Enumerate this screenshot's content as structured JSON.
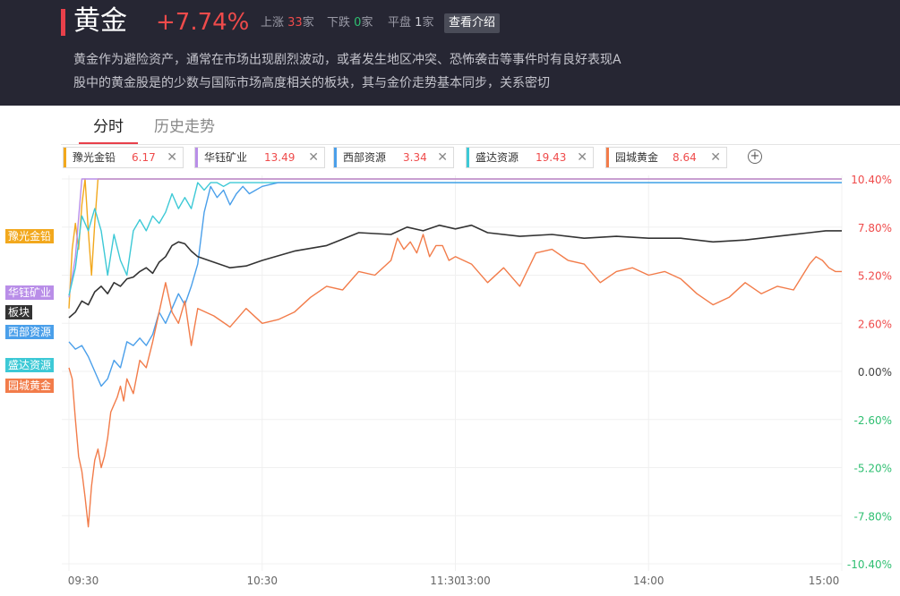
{
  "header": {
    "title": "黄金",
    "change": "+7.74%",
    "up_label": "上涨",
    "up_count": "33",
    "up_unit": "家",
    "down_label": "下跌",
    "down_count": "0",
    "down_unit": "家",
    "flat_label": "平盘",
    "flat_count": "1",
    "flat_unit": "家",
    "intro_button": "查看介绍",
    "description_line1": "黄金作为避险资产，通常在市场出现剧烈波动，或者发生地区冲突、恐怖袭击等事件时有良好表现A",
    "description_line2": "股中的黄金股是的少数与国际市场高度相关的板块，其与金价走势基本同步，关系密切"
  },
  "tabs": [
    {
      "label": "分时",
      "active": true
    },
    {
      "label": "历史走势",
      "active": false
    }
  ],
  "chips": [
    {
      "name": "豫光金铅",
      "value": "6.17",
      "color": "#f2a81d"
    },
    {
      "name": "华钰矿业",
      "value": "13.49",
      "color": "#b98ee8"
    },
    {
      "name": "西部资源",
      "value": "3.34",
      "color": "#4a9fea"
    },
    {
      "name": "盛达资源",
      "value": "19.43",
      "color": "#3dc9d6"
    },
    {
      "name": "园城黄金",
      "value": "8.64",
      "color": "#f27c4a"
    }
  ],
  "colors": {
    "sector": "#333333",
    "up": "#ef4b4b",
    "down": "#2fbf71"
  },
  "chart_data": {
    "type": "line",
    "x_ticks": [
      "09:30",
      "10:30",
      "11:30",
      "13:00",
      "14:00",
      "15:00"
    ],
    "y_ticks": [
      "10.40%",
      "7.80%",
      "5.20%",
      "2.60%",
      "0.00%",
      "-2.60%",
      "-5.20%",
      "-7.80%",
      "-10.40%"
    ],
    "ylim": [
      -10.4,
      10.4
    ],
    "x_unit": "minutes of trading session (0–240)",
    "series": [
      {
        "name": "板块",
        "color": "#333333",
        "x": [
          0,
          2,
          4,
          6,
          8,
          10,
          12,
          14,
          16,
          18,
          20,
          22,
          24,
          26,
          28,
          30,
          32,
          34,
          36,
          38,
          40,
          45,
          50,
          55,
          60,
          70,
          80,
          90,
          100,
          105,
          110,
          115,
          120,
          125,
          130,
          140,
          150,
          160,
          170,
          180,
          190,
          200,
          210,
          220,
          230,
          235,
          240
        ],
        "y": [
          2.9,
          3.2,
          3.8,
          3.6,
          4.3,
          4.6,
          4.2,
          4.8,
          4.6,
          5.0,
          5.1,
          5.4,
          5.6,
          5.3,
          5.9,
          6.2,
          6.8,
          7.0,
          6.9,
          6.5,
          6.2,
          5.9,
          5.6,
          5.7,
          6.0,
          6.5,
          6.8,
          7.5,
          7.4,
          7.8,
          7.6,
          7.9,
          7.7,
          7.9,
          7.5,
          7.3,
          7.4,
          7.2,
          7.3,
          7.2,
          7.2,
          7.0,
          7.1,
          7.3,
          7.5,
          7.6,
          7.6
        ]
      },
      {
        "name": "豫光金铅",
        "color": "#f2a81d",
        "x": [
          0,
          1,
          2,
          3,
          4,
          5,
          6,
          7,
          8,
          9,
          10,
          240
        ],
        "y": [
          3.4,
          6.6,
          8.0,
          6.6,
          9.0,
          10.4,
          7.6,
          5.2,
          8.0,
          10.4,
          10.4,
          10.4
        ]
      },
      {
        "name": "盛达资源",
        "color": "#3dc9d6",
        "x": [
          0,
          2,
          4,
          6,
          8,
          10,
          12,
          14,
          16,
          18,
          20,
          22,
          24,
          26,
          28,
          30,
          32,
          34,
          36,
          38,
          40,
          42,
          44,
          46,
          48,
          50,
          55,
          60,
          65,
          240
        ],
        "y": [
          4.1,
          5.6,
          8.4,
          7.6,
          8.8,
          7.6,
          5.2,
          7.4,
          6.0,
          5.2,
          7.6,
          8.2,
          7.6,
          8.4,
          8.0,
          8.6,
          9.6,
          8.8,
          9.4,
          8.8,
          10.2,
          9.8,
          10.2,
          10.2,
          10.0,
          10.2,
          10.2,
          10.2,
          10.2,
          10.2
        ]
      },
      {
        "name": "华钰矿业",
        "color": "#b98ee8",
        "x": [
          0,
          2,
          4,
          6,
          240
        ],
        "y": [
          4.0,
          6.2,
          10.4,
          10.4,
          10.4
        ]
      },
      {
        "name": "西部资源",
        "color": "#4a9fea",
        "x": [
          0,
          2,
          4,
          6,
          8,
          10,
          12,
          14,
          16,
          18,
          20,
          22,
          24,
          26,
          28,
          30,
          32,
          34,
          36,
          38,
          40,
          42,
          44,
          46,
          48,
          50,
          52,
          54,
          56,
          58,
          60,
          65,
          70,
          240
        ],
        "y": [
          1.6,
          1.2,
          1.4,
          0.8,
          0.0,
          -0.8,
          -0.4,
          0.6,
          0.2,
          1.6,
          1.4,
          1.8,
          1.4,
          2.0,
          3.2,
          2.6,
          3.4,
          4.2,
          3.6,
          4.6,
          5.8,
          8.6,
          10.0,
          9.4,
          9.8,
          9.0,
          9.6,
          10.0,
          9.6,
          9.8,
          10.0,
          10.2,
          10.2,
          10.2
        ]
      },
      {
        "name": "园城黄金",
        "color": "#f27c4a",
        "x": [
          0,
          1,
          2,
          3,
          4,
          5,
          6,
          7,
          8,
          9,
          10,
          11,
          12,
          13,
          14,
          15,
          16,
          17,
          18,
          20,
          22,
          24,
          26,
          28,
          30,
          32,
          34,
          36,
          38,
          40,
          45,
          50,
          55,
          60,
          65,
          70,
          75,
          80,
          85,
          90,
          95,
          100,
          102,
          104,
          106,
          108,
          110,
          112,
          114,
          116,
          118,
          120,
          125,
          130,
          135,
          140,
          145,
          150,
          155,
          160,
          165,
          170,
          175,
          180,
          185,
          190,
          195,
          200,
          205,
          210,
          215,
          220,
          225,
          230,
          232,
          234,
          236,
          238,
          240
        ],
        "y": [
          0.2,
          -0.4,
          -2.6,
          -4.6,
          -5.4,
          -6.8,
          -8.4,
          -6.2,
          -4.8,
          -4.2,
          -5.2,
          -4.6,
          -3.6,
          -2.2,
          -1.8,
          -1.4,
          -0.8,
          -1.6,
          -0.4,
          -1.2,
          0.6,
          0.2,
          1.6,
          3.2,
          4.8,
          3.2,
          2.6,
          3.8,
          1.4,
          3.4,
          3.0,
          2.4,
          3.4,
          2.6,
          2.8,
          3.2,
          4.0,
          4.6,
          4.4,
          5.4,
          5.2,
          6.0,
          7.2,
          6.6,
          7.0,
          6.4,
          7.4,
          6.2,
          6.8,
          6.8,
          6.0,
          6.2,
          5.8,
          4.8,
          5.6,
          4.6,
          6.4,
          6.6,
          6.0,
          5.8,
          4.8,
          5.4,
          5.6,
          5.2,
          5.4,
          5.0,
          4.2,
          3.6,
          4.0,
          4.8,
          4.2,
          4.6,
          4.4,
          5.8,
          6.2,
          6.0,
          5.6,
          5.4,
          5.4
        ]
      }
    ]
  }
}
